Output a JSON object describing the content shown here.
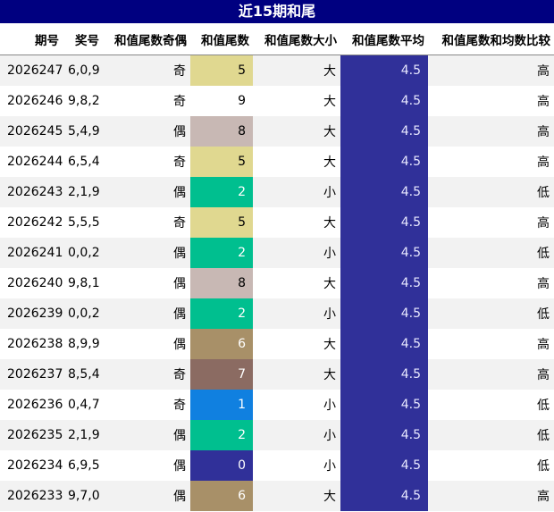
{
  "title": "近15期和尾",
  "headers": [
    "期号",
    "奖号",
    "和值尾数奇偶",
    "和值尾数",
    "和值尾数大小",
    "和值尾数平均",
    "和值尾数和均数比较"
  ],
  "tail_colors": {
    "0": "#303099",
    "1": "#1080e0",
    "2": "#00bf8f",
    "5": "#e0d890",
    "6": "#a89068",
    "7": "#8b6b62",
    "8": "#c8b8b4",
    "9": "#ffffff"
  },
  "rows": [
    {
      "period": "2026247",
      "nums": "6,0,9",
      "parity": "奇",
      "tail": "5",
      "size": "大",
      "avg": "4.5",
      "cmp": "高"
    },
    {
      "period": "2026246",
      "nums": "9,8,2",
      "parity": "奇",
      "tail": "9",
      "size": "大",
      "avg": "4.5",
      "cmp": "高"
    },
    {
      "period": "2026245",
      "nums": "5,4,9",
      "parity": "偶",
      "tail": "8",
      "size": "大",
      "avg": "4.5",
      "cmp": "高"
    },
    {
      "period": "2026244",
      "nums": "6,5,4",
      "parity": "奇",
      "tail": "5",
      "size": "大",
      "avg": "4.5",
      "cmp": "高"
    },
    {
      "period": "2026243",
      "nums": "2,1,9",
      "parity": "偶",
      "tail": "2",
      "size": "小",
      "avg": "4.5",
      "cmp": "低"
    },
    {
      "period": "2026242",
      "nums": "5,5,5",
      "parity": "奇",
      "tail": "5",
      "size": "大",
      "avg": "4.5",
      "cmp": "高"
    },
    {
      "period": "2026241",
      "nums": "0,0,2",
      "parity": "偶",
      "tail": "2",
      "size": "小",
      "avg": "4.5",
      "cmp": "低"
    },
    {
      "period": "2026240",
      "nums": "9,8,1",
      "parity": "偶",
      "tail": "8",
      "size": "大",
      "avg": "4.5",
      "cmp": "高"
    },
    {
      "period": "2026239",
      "nums": "0,0,2",
      "parity": "偶",
      "tail": "2",
      "size": "小",
      "avg": "4.5",
      "cmp": "低"
    },
    {
      "period": "2026238",
      "nums": "8,9,9",
      "parity": "偶",
      "tail": "6",
      "size": "大",
      "avg": "4.5",
      "cmp": "高"
    },
    {
      "period": "2026237",
      "nums": "8,5,4",
      "parity": "奇",
      "tail": "7",
      "size": "大",
      "avg": "4.5",
      "cmp": "高"
    },
    {
      "period": "2026236",
      "nums": "0,4,7",
      "parity": "奇",
      "tail": "1",
      "size": "小",
      "avg": "4.5",
      "cmp": "低"
    },
    {
      "period": "2026235",
      "nums": "2,1,9",
      "parity": "偶",
      "tail": "2",
      "size": "小",
      "avg": "4.5",
      "cmp": "低"
    },
    {
      "period": "2026234",
      "nums": "6,9,5",
      "parity": "偶",
      "tail": "0",
      "size": "小",
      "avg": "4.5",
      "cmp": "低"
    },
    {
      "period": "2026233",
      "nums": "9,7,0",
      "parity": "偶",
      "tail": "6",
      "size": "大",
      "avg": "4.5",
      "cmp": "高"
    }
  ]
}
